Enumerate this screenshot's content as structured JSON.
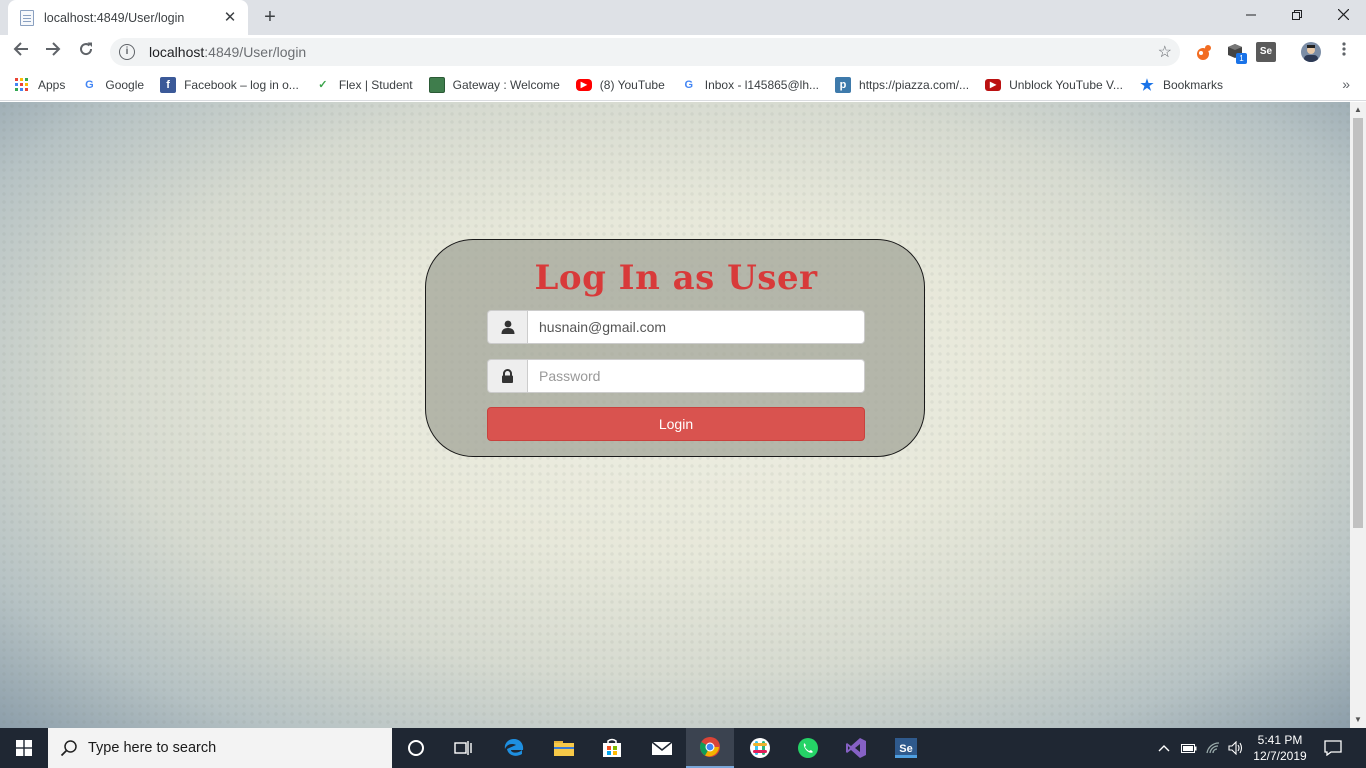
{
  "browser": {
    "tab_title": "localhost:4849/User/login",
    "tab_close": "✕",
    "new_tab": "+",
    "url_host": "localhost",
    "url_path": ":4849/User/login",
    "bookmarks": [
      {
        "label": "Apps",
        "icon": "apps-grid-icon"
      },
      {
        "label": "Google",
        "icon": "google-icon"
      },
      {
        "label": "Facebook – log in o...",
        "icon": "facebook-icon"
      },
      {
        "label": "Flex | Student",
        "icon": "flex-icon"
      },
      {
        "label": "Gateway : Welcome",
        "icon": "gateway-icon"
      },
      {
        "label": "(8) YouTube",
        "icon": "youtube-icon"
      },
      {
        "label": "Inbox - l145865@lh...",
        "icon": "google-icon"
      },
      {
        "label": "https://piazza.com/...",
        "icon": "piazza-icon"
      },
      {
        "label": "Unblock YouTube V...",
        "icon": "youtube-icon"
      },
      {
        "label": "Bookmarks",
        "icon": "star-icon"
      }
    ],
    "extension_badge": "1",
    "selenium_label": "Se"
  },
  "login": {
    "title": "Log In as User",
    "email_value": "husnain@gmail.com",
    "password_placeholder": "Password",
    "button_label": "Login"
  },
  "taskbar": {
    "search_placeholder": "Type here to search",
    "time": "5:41 PM",
    "date": "12/7/2019",
    "selenium_label": "Se"
  },
  "colors": {
    "title_red": "#d83a3a",
    "button_red": "#d9534f",
    "taskbar_bg": "#1f2733"
  }
}
